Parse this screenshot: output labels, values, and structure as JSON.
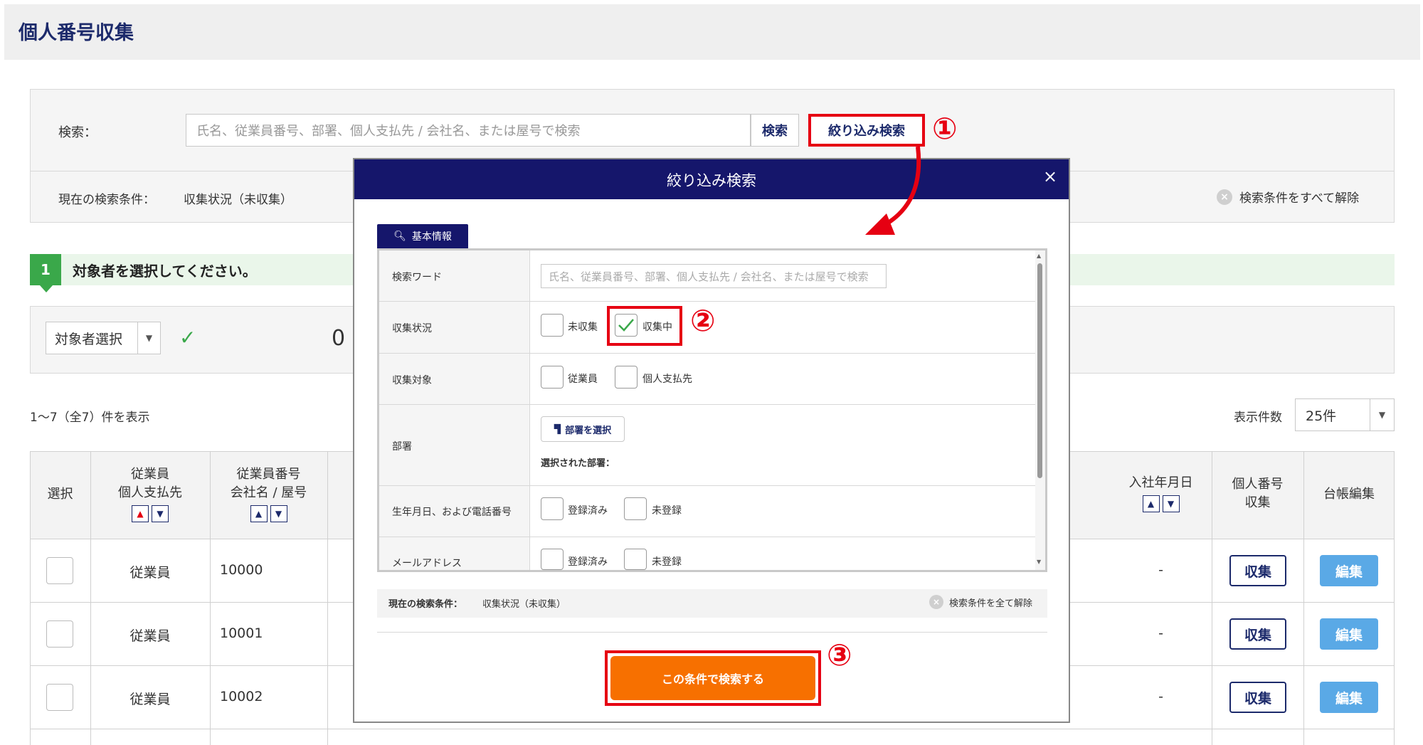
{
  "page": {
    "title": "個人番号収集"
  },
  "search": {
    "label": "検索：",
    "placeholder": "氏名、従業員番号、部署、個人支払先 / 会社名、または屋号で検索",
    "search_button": "検索",
    "filter_button": "絞り込み検索",
    "current_conditions_label": "現在の検索条件：",
    "current_conditions_value": "収集状況（未収集）",
    "clear_all": "検索条件をすべて解除"
  },
  "step": {
    "number": "1",
    "text": "対象者を選択してください。"
  },
  "selection": {
    "target_select": "対象者選択",
    "count": "0"
  },
  "listing": {
    "range": "1〜7（全7）件を表示",
    "per_page_label": "表示件数",
    "per_page_value": "25件"
  },
  "table": {
    "headers": {
      "select": "選択",
      "type_line1": "従業員",
      "type_line2": "個人支払先",
      "number_line1": "従業員番号",
      "number_line2": "会社名 / 屋号",
      "hire_date": "入社年月日",
      "mynumber_line1": "個人番号",
      "mynumber_line2": "収集",
      "ledger_edit": "台帳編集"
    },
    "rows": [
      {
        "type": "従業員",
        "number": "10000",
        "hire_date": "-",
        "collect": "収集",
        "edit": "編集"
      },
      {
        "type": "従業員",
        "number": "10001",
        "hire_date": "-",
        "collect": "収集",
        "edit": "編集"
      },
      {
        "type": "従業員",
        "number": "10002",
        "hire_date": "-",
        "collect": "収集",
        "edit": "編集"
      }
    ]
  },
  "modal": {
    "title": "絞り込み検索",
    "close": "×",
    "tab": "基本情報",
    "fields": {
      "keyword_label": "検索ワード",
      "keyword_placeholder": "氏名、従業員番号、部署、個人支払先 / 会社名、または屋号で検索",
      "status_label": "収集状況",
      "status_opt1": "未収集",
      "status_opt2": "収集中",
      "target_label": "収集対象",
      "target_opt1": "従業員",
      "target_opt2": "個人支払先",
      "dept_label": "部署",
      "dept_button": "部署を選択",
      "dept_selected": "選択された部署：",
      "birth_label": "生年月日、および電話番号",
      "birth_opt1": "登録済み",
      "birth_opt2": "未登録",
      "mail_label": "メールアドレス",
      "mail_opt1": "登録済み",
      "mail_opt2": "未登録"
    },
    "current_label": "現在の検索条件：",
    "current_value": "収集状況（未収集）",
    "clear_all": "検索条件を全て解除",
    "submit": "この条件で検索する"
  },
  "annotations": {
    "one": "①",
    "two": "②",
    "three": "③"
  },
  "colors": {
    "navy": "#15166b",
    "accent_red": "#e60012",
    "orange": "#f77000",
    "green": "#3aa84a",
    "edit_blue": "#5aa9e6"
  }
}
